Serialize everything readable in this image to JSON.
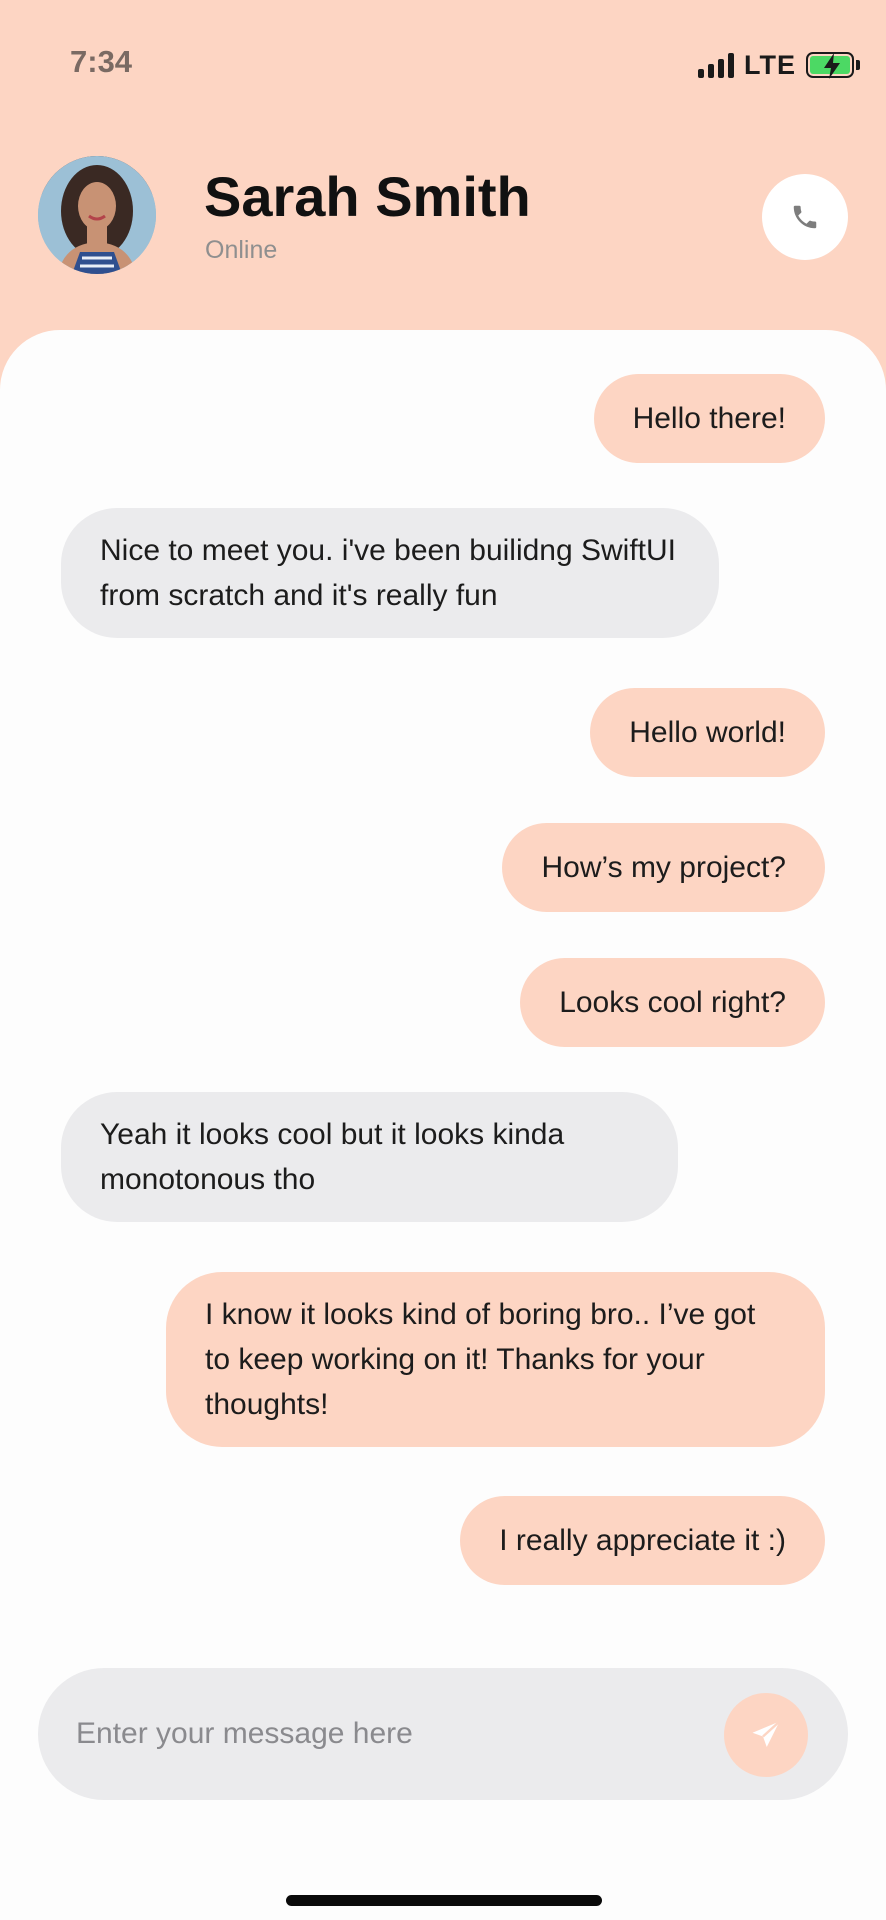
{
  "status_bar": {
    "time": "7:34",
    "network": "LTE",
    "battery_charging": true
  },
  "contact": {
    "name": "Sarah Smith",
    "status": "Online"
  },
  "messages": [
    {
      "from": "me",
      "text": "Hello there!"
    },
    {
      "from": "them",
      "text": "Nice to meet you. i've been builidng SwiftUI from scratch and it's really fun"
    },
    {
      "from": "me",
      "text": "Hello world!"
    },
    {
      "from": "me",
      "text": "How’s my project?"
    },
    {
      "from": "me",
      "text": "Looks cool right?"
    },
    {
      "from": "them",
      "text": "Yeah it looks cool but it looks kinda monotonous tho"
    },
    {
      "from": "me",
      "text": "I know it looks kind of boring bro.. I’ve got to keep working on it! Thanks for your thoughts!"
    },
    {
      "from": "me",
      "text": "I really appreciate it :)"
    }
  ],
  "composer": {
    "placeholder": "Enter your message here",
    "value": ""
  },
  "icons": {
    "call": "phone-icon",
    "send": "send-icon"
  },
  "colors": {
    "accent": "#fdd5c3",
    "received_bubble": "#ebebed",
    "background": "#fdfdfd"
  }
}
